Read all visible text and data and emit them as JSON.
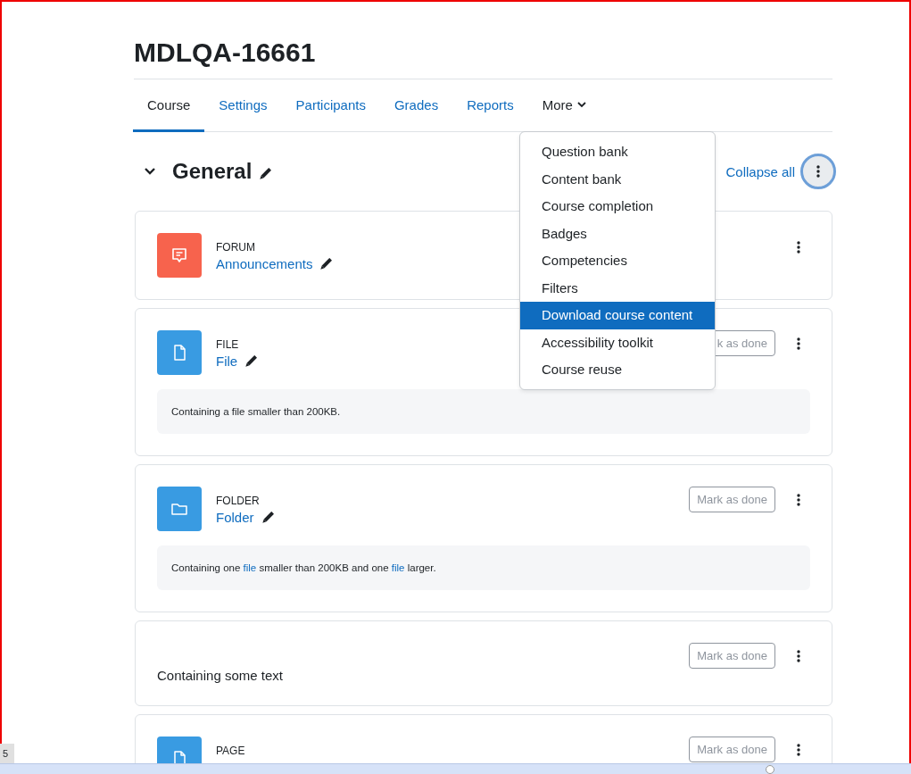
{
  "page_title": "MDLQA-16661",
  "tabs": [
    {
      "label": "Course",
      "selected": true,
      "dropdown": false
    },
    {
      "label": "Settings",
      "selected": false,
      "dropdown": false
    },
    {
      "label": "Participants",
      "selected": false,
      "dropdown": false
    },
    {
      "label": "Grades",
      "selected": false,
      "dropdown": false
    },
    {
      "label": "Reports",
      "selected": false,
      "dropdown": false
    },
    {
      "label": "More",
      "selected": false,
      "dropdown": true
    }
  ],
  "more_menu": [
    {
      "label": "Question bank",
      "selected": false
    },
    {
      "label": "Content bank",
      "selected": false
    },
    {
      "label": "Course completion",
      "selected": false
    },
    {
      "label": "Badges",
      "selected": false
    },
    {
      "label": "Competencies",
      "selected": false
    },
    {
      "label": "Filters",
      "selected": false
    },
    {
      "label": "Download course content",
      "selected": true
    },
    {
      "label": "Accessibility toolkit",
      "selected": false
    },
    {
      "label": "Course reuse",
      "selected": false
    }
  ],
  "section": {
    "title": "General",
    "expanded": true,
    "collapse_link": "Collapse all"
  },
  "activities": [
    {
      "kind": "forum",
      "type_label": "FORUM",
      "name": "Announcements"
    },
    {
      "kind": "file",
      "type_label": "FILE",
      "name": "File",
      "button": "k as done",
      "description": [
        {
          "text": "Containing a file smaller than 200KB.",
          "link": false
        }
      ]
    },
    {
      "kind": "folder",
      "type_label": "FOLDER",
      "name": "Folder",
      "button": "Mark as done",
      "description": [
        {
          "text": "Containing one ",
          "link": false
        },
        {
          "text": "file",
          "link": true
        },
        {
          "text": " smaller than 200KB and one ",
          "link": false
        },
        {
          "text": "file",
          "link": true
        },
        {
          "text": " larger.",
          "link": false
        }
      ]
    },
    {
      "kind": "label",
      "text": "Containing some text",
      "button": "Mark as done"
    },
    {
      "kind": "page",
      "type_label": "PAGE",
      "button": "Mark as done"
    }
  ],
  "side_tab": "5"
}
